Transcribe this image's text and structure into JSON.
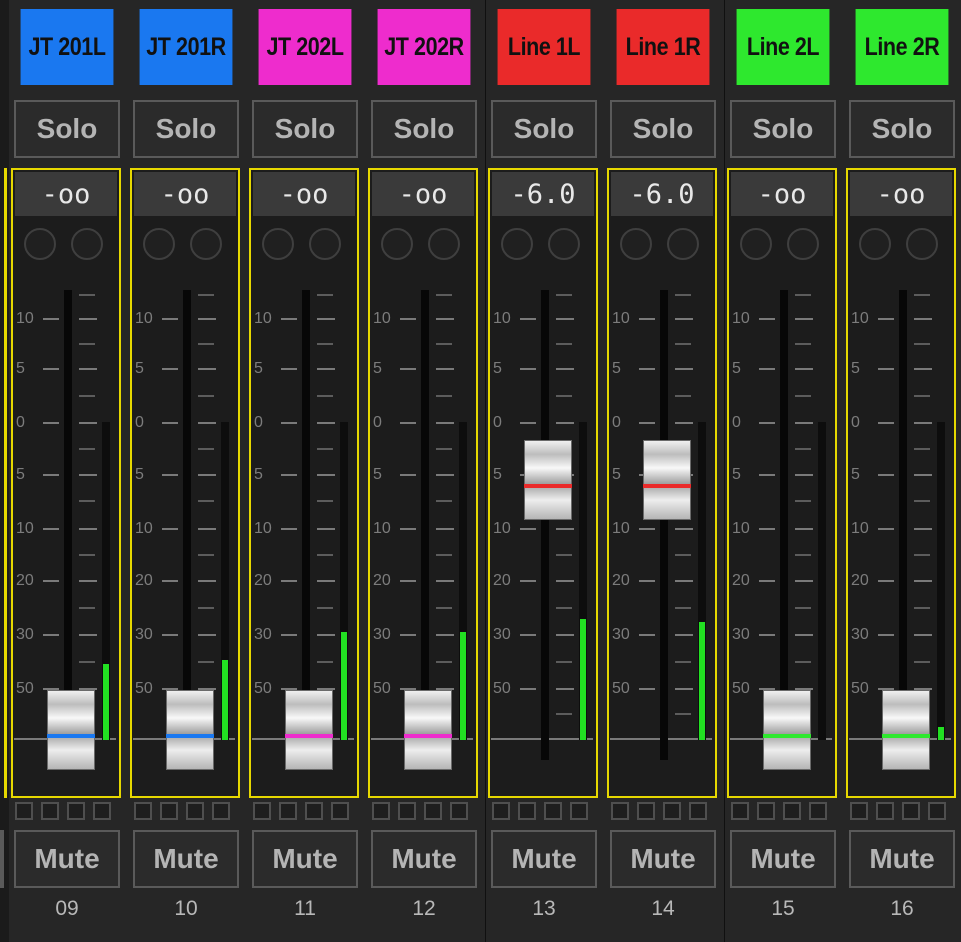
{
  "scale_labels": [
    "10",
    "5",
    "0",
    "5",
    "10",
    "20",
    "30",
    "50"
  ],
  "solo_label": "Solo",
  "mute_label": "Mute",
  "channels": [
    {
      "number": "09",
      "name": "JT 201L",
      "color": "#1a78f0",
      "value": "-oo",
      "fader_db": "-oo",
      "meter_level": 0.24,
      "fader_color": "#1a78f0"
    },
    {
      "number": "10",
      "name": "JT 201R",
      "color": "#1a78f0",
      "value": "-oo",
      "fader_db": "-oo",
      "meter_level": 0.25,
      "fader_color": "#1a78f0"
    },
    {
      "number": "11",
      "name": "JT 202L",
      "color": "#ee2ccd",
      "value": "-oo",
      "fader_db": "-oo",
      "meter_level": 0.34,
      "fader_color": "#ee2ccd"
    },
    {
      "number": "12",
      "name": "JT 202R",
      "color": "#ee2ccd",
      "value": "-oo",
      "fader_db": "-oo",
      "meter_level": 0.34,
      "fader_color": "#ee2ccd"
    },
    {
      "number": "13",
      "name": "Line 1L",
      "color": "#ea2a2a",
      "value": "-6.0",
      "fader_db": -6.0,
      "meter_level": 0.38,
      "fader_color": "#ea2a2a"
    },
    {
      "number": "14",
      "name": "Line 1R",
      "color": "#ea2a2a",
      "value": "-6.0",
      "fader_db": -6.0,
      "meter_level": 0.37,
      "fader_color": "#ea2a2a"
    },
    {
      "number": "15",
      "name": "Line 2L",
      "color": "#2ee82e",
      "value": "-oo",
      "fader_db": "-oo",
      "meter_level": 0.0,
      "fader_color": "#2ee82e"
    },
    {
      "number": "16",
      "name": "Line 2R",
      "color": "#2ee82e",
      "value": "-oo",
      "fader_db": "-oo",
      "meter_level": 0.04,
      "fader_color": "#2ee82e"
    }
  ]
}
